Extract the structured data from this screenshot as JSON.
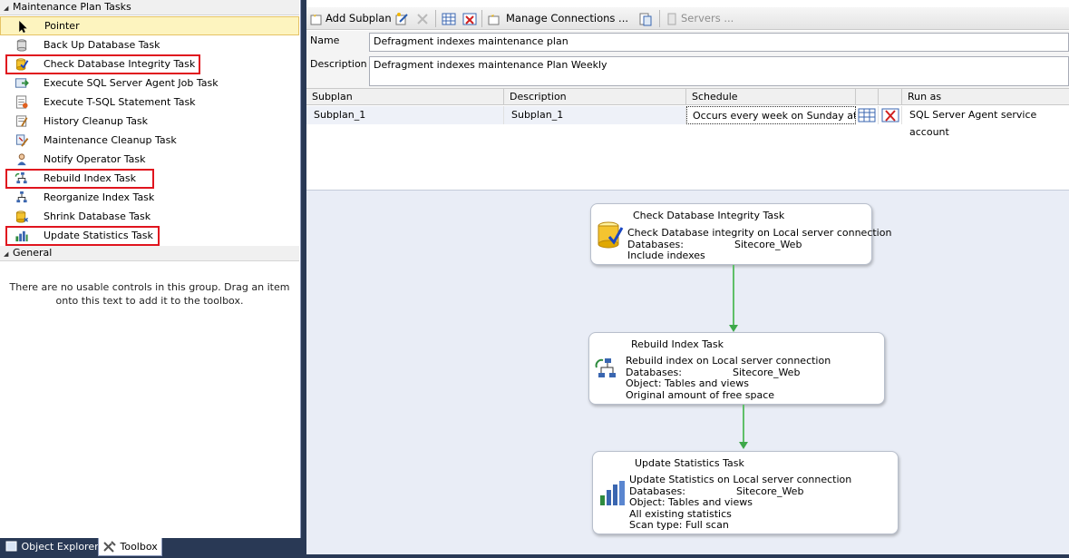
{
  "toolbox": {
    "group1_title": "Maintenance Plan Tasks",
    "items": [
      {
        "label": "Pointer",
        "icon": "pointer-icon"
      },
      {
        "label": "Back Up Database Task",
        "icon": "backup-database-icon"
      },
      {
        "label": "Check Database Integrity Task",
        "icon": "check-integrity-icon"
      },
      {
        "label": "Execute SQL Server Agent Job Task",
        "icon": "agent-job-icon"
      },
      {
        "label": "Execute T-SQL Statement Task",
        "icon": "tsql-statement-icon"
      },
      {
        "label": "History Cleanup Task",
        "icon": "history-cleanup-icon"
      },
      {
        "label": "Maintenance Cleanup Task",
        "icon": "maintenance-cleanup-icon"
      },
      {
        "label": "Notify Operator Task",
        "icon": "notify-operator-icon"
      },
      {
        "label": "Rebuild Index Task",
        "icon": "rebuild-index-icon"
      },
      {
        "label": "Reorganize Index Task",
        "icon": "reorganize-index-icon"
      },
      {
        "label": "Shrink Database Task",
        "icon": "shrink-database-icon"
      },
      {
        "label": "Update Statistics Task",
        "icon": "update-statistics-icon"
      }
    ],
    "group2_title": "General",
    "general_message": "There are no usable controls in this group. Drag an item onto this text to add it to the toolbox."
  },
  "bottom_tabs": {
    "object_explorer": "Object Explorer",
    "toolbox": "Toolbox"
  },
  "toolbar": {
    "add_subplan": "Add Subplan",
    "manage_connections": "Manage Connections ...",
    "servers": "Servers ..."
  },
  "plan": {
    "name_label": "Name",
    "name_value": "Defragment indexes maintenance plan",
    "description_label": "Description",
    "description_value": "Defragment indexes maintenance Plan Weekly"
  },
  "subplan_grid": {
    "headers": [
      "Subplan",
      "Description",
      "Schedule",
      "",
      "",
      "Run as"
    ],
    "rows": [
      {
        "subplan": "Subplan_1",
        "description": "Subplan_1",
        "schedule": "Occurs every week on Sunday at…",
        "run_as": "SQL Server Agent service account"
      }
    ]
  },
  "tasks": {
    "check_integrity": {
      "title": "Check Database Integrity Task",
      "line1": "Check Database integrity on Local server connection",
      "db_label": "Databases:",
      "db_value": "Sitecore_Web",
      "line3": "Include indexes"
    },
    "rebuild_index": {
      "title": "Rebuild Index Task",
      "line1": "Rebuild index on Local server connection",
      "db_label": "Databases:",
      "db_value": "Sitecore_Web",
      "line3": "Object: Tables and views",
      "line4": "Original amount of free space"
    },
    "update_statistics": {
      "title": "Update Statistics Task",
      "line1": "Update Statistics on Local server connection",
      "db_label": "Databases:",
      "db_value": "Sitecore_Web",
      "line3": "Object: Tables and views",
      "line4": "All existing statistics",
      "line5": "Scan type: Full scan"
    }
  },
  "colors": {
    "highlight_red": "#e0141e",
    "connector_green": "#5fbf68",
    "canvas_bg": "#e9edf6",
    "frame_dark": "#293955"
  }
}
